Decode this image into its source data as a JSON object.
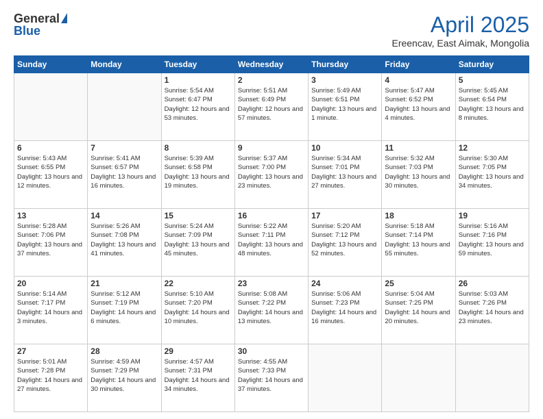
{
  "header": {
    "logo_general": "General",
    "logo_blue": "Blue",
    "title": "April 2025",
    "location": "Ereencav, East Aimak, Mongolia"
  },
  "weekdays": [
    "Sunday",
    "Monday",
    "Tuesday",
    "Wednesday",
    "Thursday",
    "Friday",
    "Saturday"
  ],
  "weeks": [
    [
      {
        "day": "",
        "info": ""
      },
      {
        "day": "",
        "info": ""
      },
      {
        "day": "1",
        "info": "Sunrise: 5:54 AM\nSunset: 6:47 PM\nDaylight: 12 hours\nand 53 minutes."
      },
      {
        "day": "2",
        "info": "Sunrise: 5:51 AM\nSunset: 6:49 PM\nDaylight: 12 hours\nand 57 minutes."
      },
      {
        "day": "3",
        "info": "Sunrise: 5:49 AM\nSunset: 6:51 PM\nDaylight: 13 hours\nand 1 minute."
      },
      {
        "day": "4",
        "info": "Sunrise: 5:47 AM\nSunset: 6:52 PM\nDaylight: 13 hours\nand 4 minutes."
      },
      {
        "day": "5",
        "info": "Sunrise: 5:45 AM\nSunset: 6:54 PM\nDaylight: 13 hours\nand 8 minutes."
      }
    ],
    [
      {
        "day": "6",
        "info": "Sunrise: 5:43 AM\nSunset: 6:55 PM\nDaylight: 13 hours\nand 12 minutes."
      },
      {
        "day": "7",
        "info": "Sunrise: 5:41 AM\nSunset: 6:57 PM\nDaylight: 13 hours\nand 16 minutes."
      },
      {
        "day": "8",
        "info": "Sunrise: 5:39 AM\nSunset: 6:58 PM\nDaylight: 13 hours\nand 19 minutes."
      },
      {
        "day": "9",
        "info": "Sunrise: 5:37 AM\nSunset: 7:00 PM\nDaylight: 13 hours\nand 23 minutes."
      },
      {
        "day": "10",
        "info": "Sunrise: 5:34 AM\nSunset: 7:01 PM\nDaylight: 13 hours\nand 27 minutes."
      },
      {
        "day": "11",
        "info": "Sunrise: 5:32 AM\nSunset: 7:03 PM\nDaylight: 13 hours\nand 30 minutes."
      },
      {
        "day": "12",
        "info": "Sunrise: 5:30 AM\nSunset: 7:05 PM\nDaylight: 13 hours\nand 34 minutes."
      }
    ],
    [
      {
        "day": "13",
        "info": "Sunrise: 5:28 AM\nSunset: 7:06 PM\nDaylight: 13 hours\nand 37 minutes."
      },
      {
        "day": "14",
        "info": "Sunrise: 5:26 AM\nSunset: 7:08 PM\nDaylight: 13 hours\nand 41 minutes."
      },
      {
        "day": "15",
        "info": "Sunrise: 5:24 AM\nSunset: 7:09 PM\nDaylight: 13 hours\nand 45 minutes."
      },
      {
        "day": "16",
        "info": "Sunrise: 5:22 AM\nSunset: 7:11 PM\nDaylight: 13 hours\nand 48 minutes."
      },
      {
        "day": "17",
        "info": "Sunrise: 5:20 AM\nSunset: 7:12 PM\nDaylight: 13 hours\nand 52 minutes."
      },
      {
        "day": "18",
        "info": "Sunrise: 5:18 AM\nSunset: 7:14 PM\nDaylight: 13 hours\nand 55 minutes."
      },
      {
        "day": "19",
        "info": "Sunrise: 5:16 AM\nSunset: 7:16 PM\nDaylight: 13 hours\nand 59 minutes."
      }
    ],
    [
      {
        "day": "20",
        "info": "Sunrise: 5:14 AM\nSunset: 7:17 PM\nDaylight: 14 hours\nand 3 minutes."
      },
      {
        "day": "21",
        "info": "Sunrise: 5:12 AM\nSunset: 7:19 PM\nDaylight: 14 hours\nand 6 minutes."
      },
      {
        "day": "22",
        "info": "Sunrise: 5:10 AM\nSunset: 7:20 PM\nDaylight: 14 hours\nand 10 minutes."
      },
      {
        "day": "23",
        "info": "Sunrise: 5:08 AM\nSunset: 7:22 PM\nDaylight: 14 hours\nand 13 minutes."
      },
      {
        "day": "24",
        "info": "Sunrise: 5:06 AM\nSunset: 7:23 PM\nDaylight: 14 hours\nand 16 minutes."
      },
      {
        "day": "25",
        "info": "Sunrise: 5:04 AM\nSunset: 7:25 PM\nDaylight: 14 hours\nand 20 minutes."
      },
      {
        "day": "26",
        "info": "Sunrise: 5:03 AM\nSunset: 7:26 PM\nDaylight: 14 hours\nand 23 minutes."
      }
    ],
    [
      {
        "day": "27",
        "info": "Sunrise: 5:01 AM\nSunset: 7:28 PM\nDaylight: 14 hours\nand 27 minutes."
      },
      {
        "day": "28",
        "info": "Sunrise: 4:59 AM\nSunset: 7:29 PM\nDaylight: 14 hours\nand 30 minutes."
      },
      {
        "day": "29",
        "info": "Sunrise: 4:57 AM\nSunset: 7:31 PM\nDaylight: 14 hours\nand 34 minutes."
      },
      {
        "day": "30",
        "info": "Sunrise: 4:55 AM\nSunset: 7:33 PM\nDaylight: 14 hours\nand 37 minutes."
      },
      {
        "day": "",
        "info": ""
      },
      {
        "day": "",
        "info": ""
      },
      {
        "day": "",
        "info": ""
      }
    ]
  ]
}
